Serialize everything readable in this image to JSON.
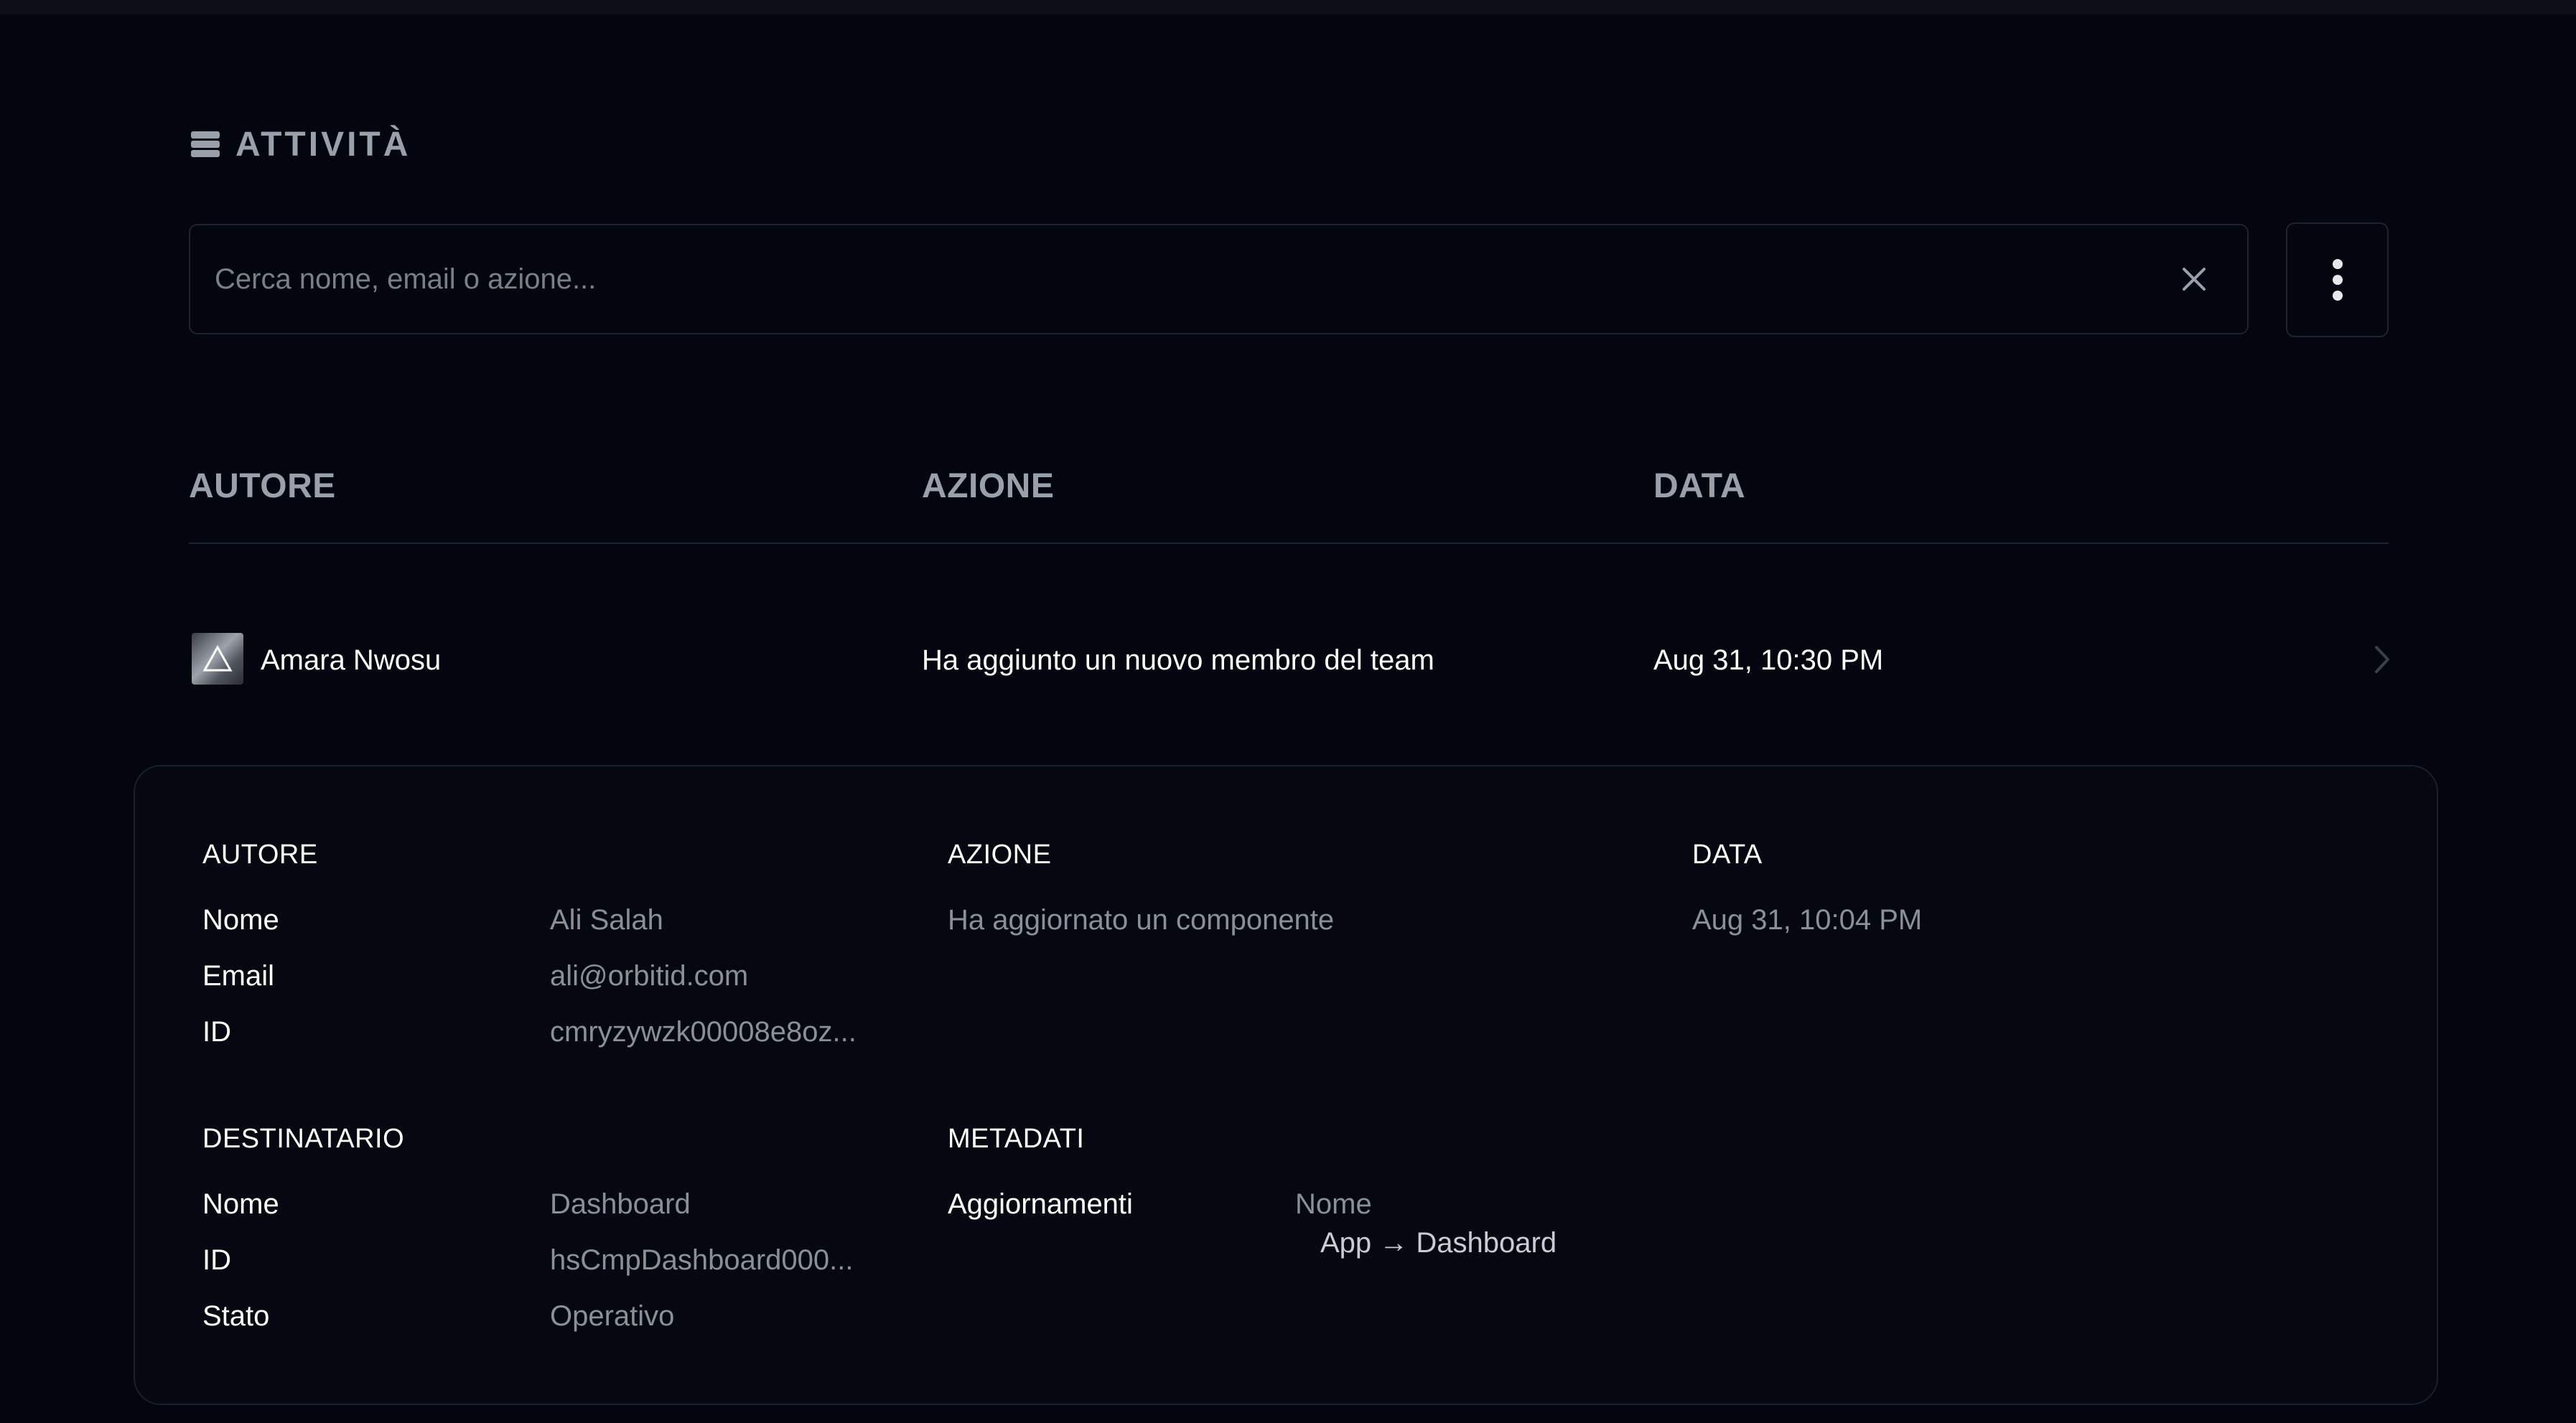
{
  "section": {
    "title": "ATTIVITÀ",
    "icon": "database-icon"
  },
  "search": {
    "placeholder": "Cerca nome, email o azione...",
    "value": ""
  },
  "table": {
    "columns": [
      "AUTORE",
      "AZIONE",
      "DATA"
    ],
    "rows": [
      {
        "author": "Amara Nwosu",
        "action": "Ha aggiunto un nuovo membro del team",
        "date": "Aug 31, 10:30 PM"
      }
    ]
  },
  "detail": {
    "author": {
      "heading": "AUTORE",
      "name_label": "Nome",
      "name_value": "Ali Salah",
      "email_label": "Email",
      "email_value": "ali@orbitid.com",
      "id_label": "ID",
      "id_value": "cmryzywzk00008e8oz..."
    },
    "action": {
      "heading": "AZIONE",
      "value": "Ha aggiornato un componente"
    },
    "date": {
      "heading": "DATA",
      "value": "Aug 31, 10:04 PM"
    },
    "recipient": {
      "heading": "DESTINATARIO",
      "name_label": "Nome",
      "name_value": "Dashboard",
      "id_label": "ID",
      "id_value": "hsCmpDashboard000...",
      "status_label": "Stato",
      "status_value": "Operativo"
    },
    "metadata": {
      "heading": "METADATI",
      "updates_label": "Aggiornamenti",
      "updates_field": "Nome",
      "updates_change": "App → Dashboard"
    }
  },
  "colors": {
    "background": "#03060e",
    "muted_text": "#8a8f98",
    "border": "#1e232d"
  }
}
